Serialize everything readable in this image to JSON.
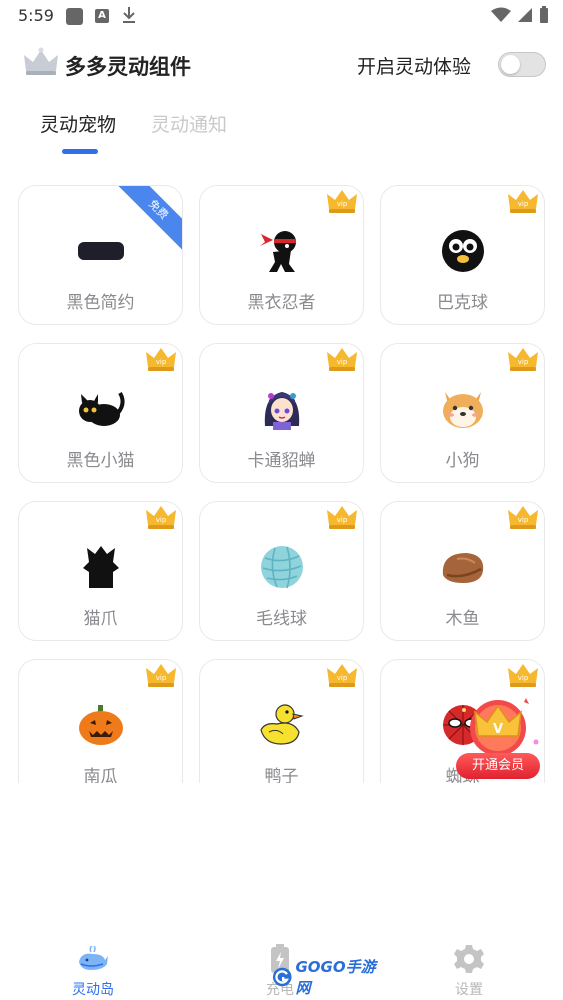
{
  "status_bar": {
    "time": "5:59"
  },
  "header": {
    "title": "多多灵动组件",
    "toggle_label": "开启灵动体验",
    "toggle_on": false
  },
  "tabs": [
    {
      "label": "灵动宠物",
      "active": true
    },
    {
      "label": "灵动通知",
      "active": false
    }
  ],
  "cards": [
    {
      "label": "黑色简约",
      "icon": "black-pill-icon",
      "badge": "免费"
    },
    {
      "label": "黑衣忍者",
      "icon": "ninja-icon",
      "badge": "vip-crown"
    },
    {
      "label": "巴克球",
      "icon": "bucky-ball-icon",
      "badge": "vip-crown"
    },
    {
      "label": "黑色小猫",
      "icon": "black-cat-icon",
      "badge": "vip-crown"
    },
    {
      "label": "卡通貂蝉",
      "icon": "cartoon-girl-icon",
      "badge": "vip-crown"
    },
    {
      "label": "小狗",
      "icon": "shiba-dog-icon",
      "badge": "vip-crown"
    },
    {
      "label": "猫爪",
      "icon": "cat-paw-icon",
      "badge": "vip-crown"
    },
    {
      "label": "毛线球",
      "icon": "yarn-ball-icon",
      "badge": "vip-crown"
    },
    {
      "label": "木鱼",
      "icon": "wooden-fish-icon",
      "badge": "vip-crown"
    },
    {
      "label": "南瓜",
      "icon": "pumpkin-icon",
      "badge": "vip-crown"
    },
    {
      "label": "鸭子",
      "icon": "duck-icon",
      "badge": "vip-crown"
    },
    {
      "label": "蜘蛛",
      "icon": "spider-mask-icon",
      "badge": "vip-crown"
    }
  ],
  "vip_float": {
    "label": "开通会员"
  },
  "bottom_nav": [
    {
      "label": "灵动岛",
      "icon": "whale-icon",
      "active": true
    },
    {
      "label": "充电",
      "icon": "battery-icon",
      "active": false
    },
    {
      "label": "设置",
      "icon": "gear-icon",
      "active": false
    }
  ],
  "watermark": {
    "text": "GOGO手游网"
  },
  "colors": {
    "accent": "#2f6fec",
    "crown": "#f5b82e",
    "vip_red": "#e0222f"
  }
}
